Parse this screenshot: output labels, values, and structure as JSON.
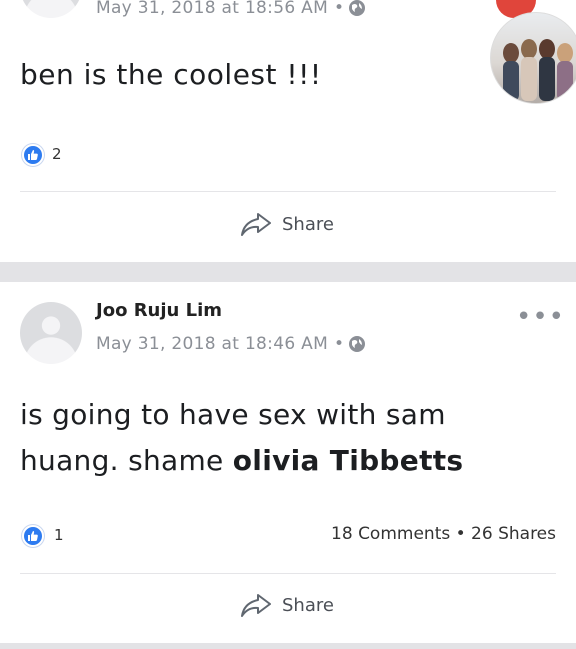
{
  "post1": {
    "timestamp": "May 31, 2018 at 18:56 AM",
    "privacy_sep": "•",
    "text": "ben is the coolest !!!",
    "like_count": "2",
    "share_label": "Share"
  },
  "post2": {
    "author": "Joo Ruju Lim",
    "timestamp": "May 31, 2018 at 18:46 AM",
    "privacy_sep": "•",
    "text_line1": "is going to have sex with sam",
    "text_line2_prefix": "huang. shame ",
    "tagged_name": "olivia Tibbetts",
    "like_count": "1",
    "counts_text": "18 Comments • 26 Shares",
    "share_label": "Share",
    "more_label": "•••"
  },
  "colors": {
    "like_blue": "#2d7bf0",
    "separator_gray": "#e3e3e6",
    "meta_gray": "#8b8f96"
  },
  "icons": [
    "globe-icon",
    "like-icon",
    "share-icon",
    "more-options-icon"
  ]
}
